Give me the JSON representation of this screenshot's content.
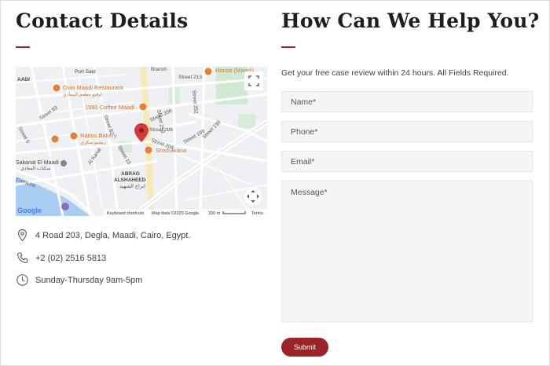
{
  "contact": {
    "title": "Contact Details",
    "address": "4 Road 203, Degla, Maadi, Cairo, Egypt.",
    "phone": "+2 (02) 2516 5813",
    "hours": "Sunday-Thursday 9am-5pm"
  },
  "map": {
    "labels": {
      "area_maadi": "AADI",
      "port_said": "Port Said",
      "ovio": "Ovio Maadi Restaurant",
      "ovio_ar": "اوفيو مطعم المعادي",
      "coffee": "1980 Coffee Maadi",
      "ratios": "Ratios Bakery",
      "ratios_ar": "ريشيو سكري",
      "shishakana": "Shishakana",
      "sakanat": "Sakanat El Maadi",
      "sakanat_ar": "سكنات المعادي",
      "abrag": "ABRAG",
      "alshaheed": "ALSHAHEED",
      "abrag_ar": "ابراج الشهيد",
      "corniche": "Corniche",
      "house": "House (Maadi)",
      "branch": "Branch",
      "street_213": "Street 213",
      "street_253": "Street 253",
      "street_252": "Street 252",
      "street_206": "Street 206",
      "street_206b": "Street 206",
      "street_204": "Street 204",
      "street_199": "Street 199",
      "street_198": "Street 198",
      "street_83": "Street 83",
      "street_15": "Street 15",
      "street_6": "Street 6",
      "al_kanal": "Al Kanal",
      "street_82": "Street 82"
    },
    "google": "Google",
    "keyboard": "Keyboard shortcuts",
    "map_data": "Map data ©2025 Google",
    "scale": "200 m",
    "terms": "Terms"
  },
  "help": {
    "title": "How Can We Help You?",
    "intro": "Get your free case review within 24 hours. All Fields Required."
  },
  "form": {
    "name_placeholder": "Name*",
    "phone_placeholder": "Phone*",
    "email_placeholder": "Email*",
    "message_placeholder": "Message*",
    "submit_label": "Submit"
  },
  "colors": {
    "accent": "#9c2428",
    "pin": "#d33b3b",
    "poi": "#e0813a",
    "park": "#cfe9d3"
  },
  "icons": {
    "address": "location-pin-icon",
    "phone": "phone-icon",
    "hours": "clock-icon"
  }
}
